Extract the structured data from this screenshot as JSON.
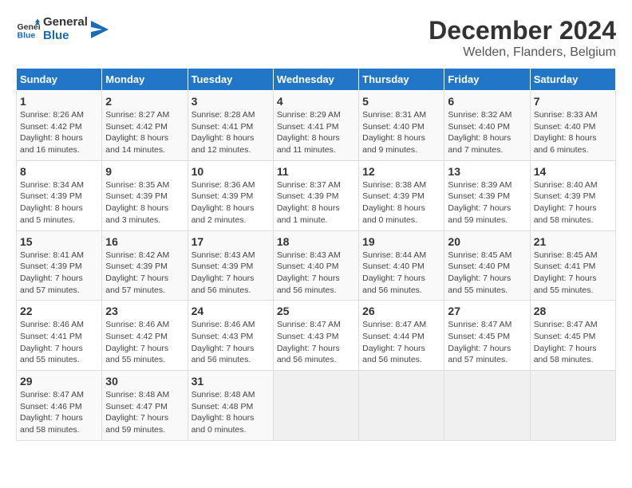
{
  "logo": {
    "text_general": "General",
    "text_blue": "Blue"
  },
  "header": {
    "title": "December 2024",
    "subtitle": "Welden, Flanders, Belgium"
  },
  "weekdays": [
    "Sunday",
    "Monday",
    "Tuesday",
    "Wednesday",
    "Thursday",
    "Friday",
    "Saturday"
  ],
  "weeks": [
    [
      {
        "day": "1",
        "detail": "Sunrise: 8:26 AM\nSunset: 4:42 PM\nDaylight: 8 hours and 16 minutes."
      },
      {
        "day": "2",
        "detail": "Sunrise: 8:27 AM\nSunset: 4:42 PM\nDaylight: 8 hours and 14 minutes."
      },
      {
        "day": "3",
        "detail": "Sunrise: 8:28 AM\nSunset: 4:41 PM\nDaylight: 8 hours and 12 minutes."
      },
      {
        "day": "4",
        "detail": "Sunrise: 8:29 AM\nSunset: 4:41 PM\nDaylight: 8 hours and 11 minutes."
      },
      {
        "day": "5",
        "detail": "Sunrise: 8:31 AM\nSunset: 4:40 PM\nDaylight: 8 hours and 9 minutes."
      },
      {
        "day": "6",
        "detail": "Sunrise: 8:32 AM\nSunset: 4:40 PM\nDaylight: 8 hours and 7 minutes."
      },
      {
        "day": "7",
        "detail": "Sunrise: 8:33 AM\nSunset: 4:40 PM\nDaylight: 8 hours and 6 minutes."
      }
    ],
    [
      {
        "day": "8",
        "detail": "Sunrise: 8:34 AM\nSunset: 4:39 PM\nDaylight: 8 hours and 5 minutes."
      },
      {
        "day": "9",
        "detail": "Sunrise: 8:35 AM\nSunset: 4:39 PM\nDaylight: 8 hours and 3 minutes."
      },
      {
        "day": "10",
        "detail": "Sunrise: 8:36 AM\nSunset: 4:39 PM\nDaylight: 8 hours and 2 minutes."
      },
      {
        "day": "11",
        "detail": "Sunrise: 8:37 AM\nSunset: 4:39 PM\nDaylight: 8 hours and 1 minute."
      },
      {
        "day": "12",
        "detail": "Sunrise: 8:38 AM\nSunset: 4:39 PM\nDaylight: 8 hours and 0 minutes."
      },
      {
        "day": "13",
        "detail": "Sunrise: 8:39 AM\nSunset: 4:39 PM\nDaylight: 7 hours and 59 minutes."
      },
      {
        "day": "14",
        "detail": "Sunrise: 8:40 AM\nSunset: 4:39 PM\nDaylight: 7 hours and 58 minutes."
      }
    ],
    [
      {
        "day": "15",
        "detail": "Sunrise: 8:41 AM\nSunset: 4:39 PM\nDaylight: 7 hours and 57 minutes."
      },
      {
        "day": "16",
        "detail": "Sunrise: 8:42 AM\nSunset: 4:39 PM\nDaylight: 7 hours and 57 minutes."
      },
      {
        "day": "17",
        "detail": "Sunrise: 8:43 AM\nSunset: 4:39 PM\nDaylight: 7 hours and 56 minutes."
      },
      {
        "day": "18",
        "detail": "Sunrise: 8:43 AM\nSunset: 4:40 PM\nDaylight: 7 hours and 56 minutes."
      },
      {
        "day": "19",
        "detail": "Sunrise: 8:44 AM\nSunset: 4:40 PM\nDaylight: 7 hours and 56 minutes."
      },
      {
        "day": "20",
        "detail": "Sunrise: 8:45 AM\nSunset: 4:40 PM\nDaylight: 7 hours and 55 minutes."
      },
      {
        "day": "21",
        "detail": "Sunrise: 8:45 AM\nSunset: 4:41 PM\nDaylight: 7 hours and 55 minutes."
      }
    ],
    [
      {
        "day": "22",
        "detail": "Sunrise: 8:46 AM\nSunset: 4:41 PM\nDaylight: 7 hours and 55 minutes."
      },
      {
        "day": "23",
        "detail": "Sunrise: 8:46 AM\nSunset: 4:42 PM\nDaylight: 7 hours and 55 minutes."
      },
      {
        "day": "24",
        "detail": "Sunrise: 8:46 AM\nSunset: 4:43 PM\nDaylight: 7 hours and 56 minutes."
      },
      {
        "day": "25",
        "detail": "Sunrise: 8:47 AM\nSunset: 4:43 PM\nDaylight: 7 hours and 56 minutes."
      },
      {
        "day": "26",
        "detail": "Sunrise: 8:47 AM\nSunset: 4:44 PM\nDaylight: 7 hours and 56 minutes."
      },
      {
        "day": "27",
        "detail": "Sunrise: 8:47 AM\nSunset: 4:45 PM\nDaylight: 7 hours and 57 minutes."
      },
      {
        "day": "28",
        "detail": "Sunrise: 8:47 AM\nSunset: 4:45 PM\nDaylight: 7 hours and 58 minutes."
      }
    ],
    [
      {
        "day": "29",
        "detail": "Sunrise: 8:47 AM\nSunset: 4:46 PM\nDaylight: 7 hours and 58 minutes."
      },
      {
        "day": "30",
        "detail": "Sunrise: 8:48 AM\nSunset: 4:47 PM\nDaylight: 7 hours and 59 minutes."
      },
      {
        "day": "31",
        "detail": "Sunrise: 8:48 AM\nSunset: 4:48 PM\nDaylight: 8 hours and 0 minutes."
      },
      null,
      null,
      null,
      null
    ]
  ]
}
